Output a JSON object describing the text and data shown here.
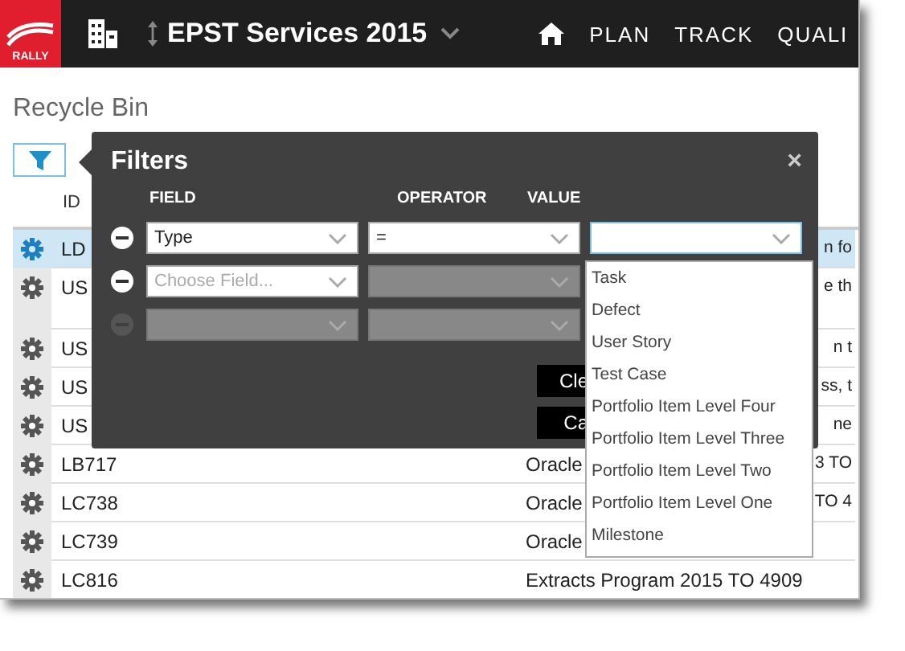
{
  "header": {
    "logo": "RALLY",
    "project": "EPST Services 2015",
    "nav": [
      {
        "label": "PLAN"
      },
      {
        "label": "TRACK"
      },
      {
        "label": "QUALI"
      }
    ]
  },
  "page_title": "Recycle Bin",
  "table": {
    "columns": [
      "ID"
    ],
    "rows": [
      {
        "id": "LD",
        "selected": true,
        "right": "n fo"
      },
      {
        "id": "US",
        "selected": false,
        "right": "e th",
        "tall": true
      },
      {
        "id": "US",
        "selected": false,
        "right": "n t"
      },
      {
        "id": "US",
        "selected": false,
        "right": "ss, t"
      },
      {
        "id": "US",
        "selected": false,
        "right": "ne"
      },
      {
        "id": "LB717",
        "selected": false,
        "left": "Oracle",
        "right": "3 TO"
      },
      {
        "id": "LC738",
        "selected": false,
        "left": "Oracle",
        "right": "TO 4"
      },
      {
        "id": "LC739",
        "selected": false,
        "left": "Oracle"
      },
      {
        "id": "LC816",
        "selected": false,
        "left": "Extracts Program 2015 TO 4909"
      }
    ]
  },
  "filters": {
    "title": "Filters",
    "close": "×",
    "columns": [
      "FIELD",
      "OPERATOR",
      "VALUE"
    ],
    "rows": [
      {
        "field": "Type",
        "operator": "=",
        "operator_disabled": false,
        "value_focused": true,
        "disabled": false
      },
      {
        "field_placeholder": "Choose Field...",
        "operator_disabled": true,
        "disabled": false
      },
      {
        "operator_disabled": true,
        "disabled": true
      }
    ],
    "buttons": [
      "Cle",
      "Ca"
    ],
    "options": [
      "Task",
      "Defect",
      "User Story",
      "Test Case",
      "Portfolio Item Level Four",
      "Portfolio Item Level Three",
      "Portfolio Item Level Two",
      "Portfolio Item Level One",
      "Milestone"
    ]
  }
}
